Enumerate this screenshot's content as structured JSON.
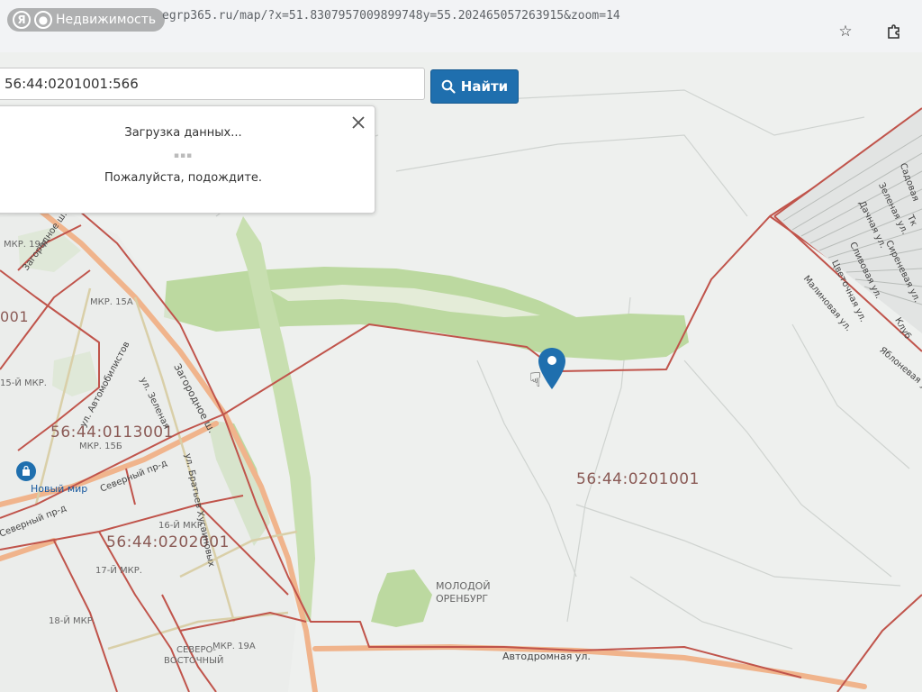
{
  "browser": {
    "brand_letter": "Я",
    "brand_label": "Недвижимость",
    "url": "egrp365.ru/map/?x=51.8307957009899748y=55.202465057263915&zoom=14",
    "icons": [
      "bookmark-star-icon",
      "extensions-puzzle-icon"
    ]
  },
  "search": {
    "value": "56:44:0201001:566",
    "button_label": "Найти",
    "button_icon": "search-icon"
  },
  "loading": {
    "title": "Загрузка данных...",
    "dots": "▪▪▪",
    "message": "Пожалуйста, подождите."
  },
  "map": {
    "cadastral_labels": {
      "block_0201001": "56:44:0201001",
      "block_0113001": "56:44:0113001",
      "block_0202001": "56:44:0202001",
      "partial_001": "001"
    },
    "district_labels": {
      "mkr_15a": "МКР. 15А",
      "mkr_15b": "МКР. 15Б",
      "mkr_16": "16-Й МКР.",
      "mkr_17": "17-Й МКР.",
      "mkr_18": "18-Й МКР.",
      "mkr_19a_top": "МКР. 19А",
      "mkr_19a_bottom": "МКР. 19А",
      "mkr_15_left": "15-Й МКР.",
      "molodoy": "МОЛОДОЙ",
      "orenburg": "ОРЕНБУРГ",
      "severo_1": "СЕВЕРО-",
      "severo_2": "ВОСТОЧНЫЙ"
    },
    "streets": {
      "zagorodnoe_1": "Загородное ш.",
      "zagorodnoe_2": "Загородное ш.",
      "avtomobilistov": "ул. Автомобилистов",
      "zelenaya_left": "ул. Зеленая",
      "bratyev": "ул. Братьев Хусаиновых",
      "severny": "Северный пр-д",
      "severny_2": "Северный пр-д",
      "avtodromnaya": "Автодромная ул.",
      "sadovaya": "Садовая",
      "zelenaya_right": "Зеленая ул.",
      "dachnaya": "Дачная ул.",
      "tk": "Тк",
      "sirenevaya": "Сиреневая ул.",
      "slivovaya": "Сливовая ул.",
      "tsvetochnaya": "Цветочная ул.",
      "malinovaya": "Малиновая ул.",
      "klub": "Клуб",
      "yablonevaya": "Яблоневая ул."
    },
    "poi": {
      "novy_mir": "Новый мир",
      "novy_mir_icon": "shopping-bag-icon"
    },
    "colors": {
      "boundary": "#c0544b",
      "main_road": "#f0b48c",
      "green": "#bcd9a0",
      "land": "#eef0ee",
      "button": "#1f6fae",
      "marker": "#1f6fae"
    }
  }
}
